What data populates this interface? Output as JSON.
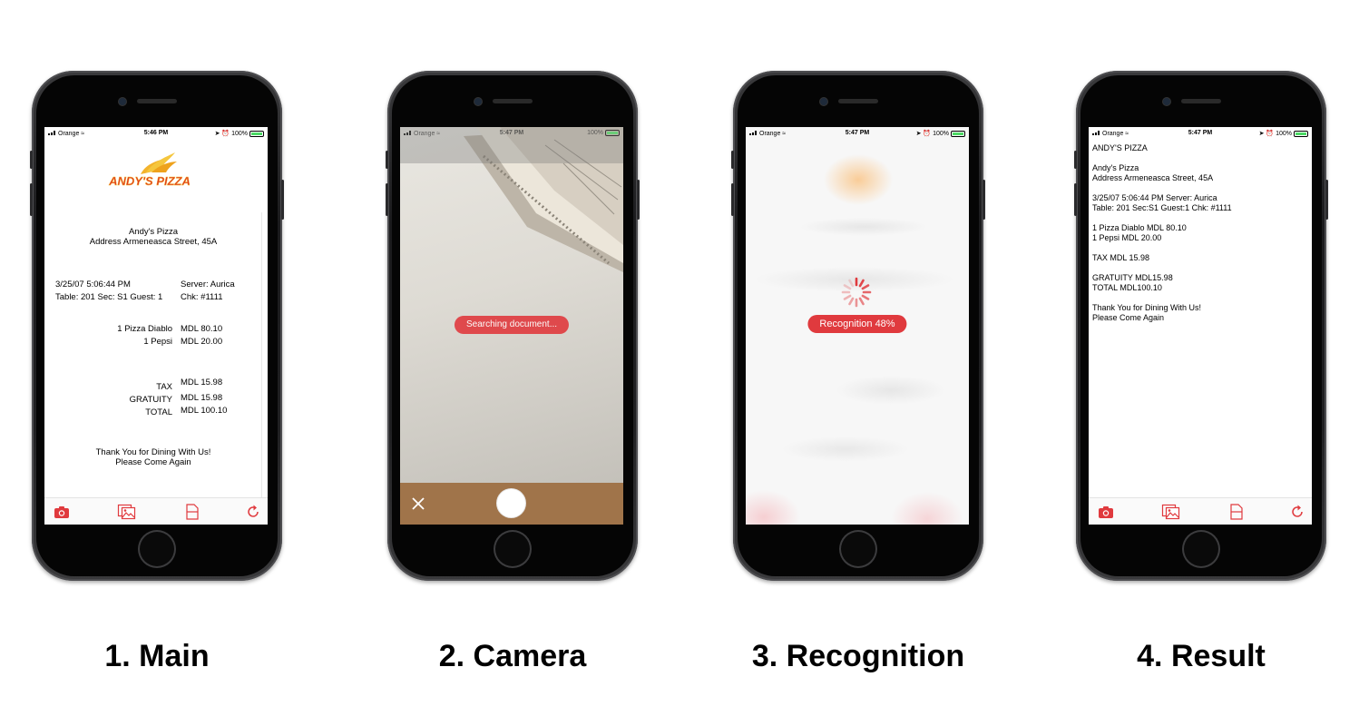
{
  "status": {
    "carrier": "Orange",
    "battery": "100%",
    "time_main": "5:46 PM",
    "time_camera": "5:47 PM",
    "time_recognition": "5:47 PM",
    "time_result": "5:47 PM"
  },
  "captions": [
    "1. Main",
    "2. Camera",
    "3. Recognition",
    "4. Result"
  ],
  "receipt": {
    "logo": "ANDY'S PIZZA",
    "name": "Andy's Pizza",
    "address": "Address Armeneasca Street, 45A",
    "datetime": "3/25/07 5:06:44 PM",
    "table_line": "Table: 201 Sec: S1  Guest: 1",
    "server": "Server: Aurica",
    "check": "Chk:  #1111",
    "items": [
      {
        "name": "1 Pizza Diablo",
        "price": "MDL 80.10"
      },
      {
        "name": "1 Pepsi",
        "price": "MDL 20.00"
      }
    ],
    "totals": [
      {
        "label": "TAX",
        "value": "MDL 15.98"
      },
      {
        "label": "GRATUITY",
        "value": "MDL 15.98"
      },
      {
        "label": "TOTAL",
        "value": "MDL 100.10"
      }
    ],
    "thanks": "Thank You for Dining With Us!",
    "come_again": "Please Come Again"
  },
  "camera": {
    "status_pill": "Searching document..."
  },
  "recognition": {
    "progress_label": "Recognition 48%",
    "progress": 0.48
  },
  "result": {
    "lines": [
      [
        "ANDY'S PIZZA"
      ],
      [
        "Andy's Pizza",
        "Address Armeneasca Street, 45A"
      ],
      [
        "3/25/07 5:06:44 PM Server: Aurica",
        "Table: 201 Sec:S1 Guest:1 Chk: #1111"
      ],
      [
        "1 Pizza Diablo MDL 80.10",
        "1 Pepsi MDL 20.00"
      ],
      [
        "TAX MDL 15.98"
      ],
      [
        "GRATUITY MDL15.98",
        "TOTAL MDL100.10"
      ],
      [
        "Thank You for Dining With Us!",
        "Please Come Again"
      ]
    ]
  },
  "toolbar": {
    "icons": [
      "camera-icon",
      "gallery-icon",
      "document-icon",
      "refresh-icon"
    ],
    "accent": "#e03a3e"
  }
}
